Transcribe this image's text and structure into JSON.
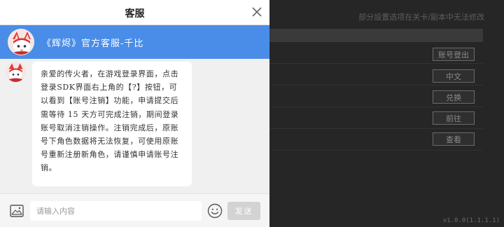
{
  "game": {
    "notice": "部分設置选项在关卡/副本中无法修改",
    "buttons": [
      {
        "label": "账号登出"
      },
      {
        "label": "中文"
      },
      {
        "label": "兑换"
      },
      {
        "label": "前往"
      },
      {
        "label": "查看"
      }
    ],
    "version": "v1.0.0(1.1.1.1)"
  },
  "panel": {
    "title": "客服",
    "agent_name": "《辉烬》官方客服-千比",
    "message": "亲爱的传火者，在游戏登录界面，点击登录SDK界面右上角的【?】按钮，可以看到【账号注销】功能，申请提交后需等待 15 天方可完成注销，期间登录账号取消注销操作。注销完成后，原账号下角色数据将无法恢复，可使用原账号重新注册新角色，请谨慎申请账号注销。",
    "input_placeholder": "请输入内容",
    "input_value": "",
    "send_label": "发送"
  },
  "icons": {
    "close": "close-icon",
    "image": "image-icon",
    "emoji": "emoji-icon"
  },
  "colors": {
    "agent_bar": "#4a8de8",
    "send_disabled": "#d3d3d3"
  }
}
